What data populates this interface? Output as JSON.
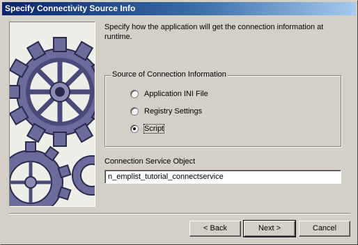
{
  "window": {
    "title": "Specify Connectivity Source Info"
  },
  "intro": {
    "text": "Specify how the application will get the connection information at runtime."
  },
  "source_group": {
    "legend": "Source of Connection Information",
    "options": [
      {
        "label": "Application INI File",
        "checked": false
      },
      {
        "label": "Registry Settings",
        "checked": false
      },
      {
        "label": "Script",
        "checked": true
      }
    ]
  },
  "connection_service": {
    "label": "Connection Service Object",
    "value": "n_emplist_tutorial_connectservice"
  },
  "buttons": {
    "back": "< Back",
    "next": "Next >",
    "cancel": "Cancel"
  },
  "colors": {
    "titlebar_start": "#0a246a",
    "titlebar_end": "#a6caf0",
    "gear": "#5a5a8c"
  }
}
